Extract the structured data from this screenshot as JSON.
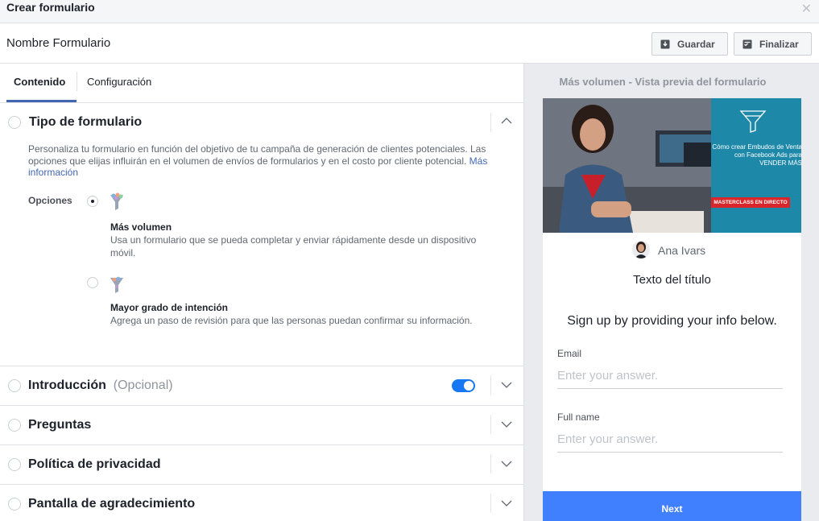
{
  "window": {
    "title": "Crear formulario",
    "close_icon": "close-icon"
  },
  "header": {
    "form_name": "Nombre Formulario",
    "save_label": "Guardar",
    "finish_label": "Finalizar"
  },
  "tabs": [
    {
      "label": "Contenido",
      "active": true
    },
    {
      "label": "Configuración",
      "active": false
    }
  ],
  "sections": {
    "form_type": {
      "title": "Tipo de formulario",
      "description": "Personaliza tu formulario en función del objetivo de tu campaña de generación de clientes potenciales. Las opciones que elijas influirán en el volumen de envíos de formularios y en el costo por cliente potencial.",
      "more_info_link": "Más información",
      "options_label": "Opciones",
      "options": [
        {
          "title": "Más volumen",
          "description": "Usa un formulario que se pueda completar y enviar rápidamente desde un dispositivo móvil.",
          "selected": true
        },
        {
          "title": "Mayor grado de intención",
          "description": "Agrega un paso de revisión para que las personas puedan confirmar su información.",
          "selected": false
        }
      ]
    },
    "intro": {
      "title": "Introducción",
      "optional": "(Opcional)",
      "enabled": true
    },
    "questions": {
      "title": "Preguntas"
    },
    "privacy": {
      "title": "Política de privacidad"
    },
    "thanks": {
      "title": "Pantalla de agradecimiento"
    }
  },
  "preview": {
    "heading": "Más volumen - Vista previa del formulario",
    "banner_text": "Cómo crear Embudos de Venta con Facebook Ads para VENDER MÁS",
    "banner_badge": "MASTERCLASS EN DIRECTO",
    "page_name": "Ana Ivars",
    "form_title": "Texto del título",
    "intro_text": "Sign up by providing your info below.",
    "fields": [
      {
        "label": "Email",
        "placeholder": "Enter your answer."
      },
      {
        "label": "Full name",
        "placeholder": "Enter your answer."
      }
    ],
    "next_label": "Next"
  },
  "colors": {
    "accent": "#4267b2",
    "toggle_on": "#1877f2",
    "next_button": "#4080ff",
    "banner_teal": "#1d88a8",
    "badge_red": "#d8262b"
  }
}
